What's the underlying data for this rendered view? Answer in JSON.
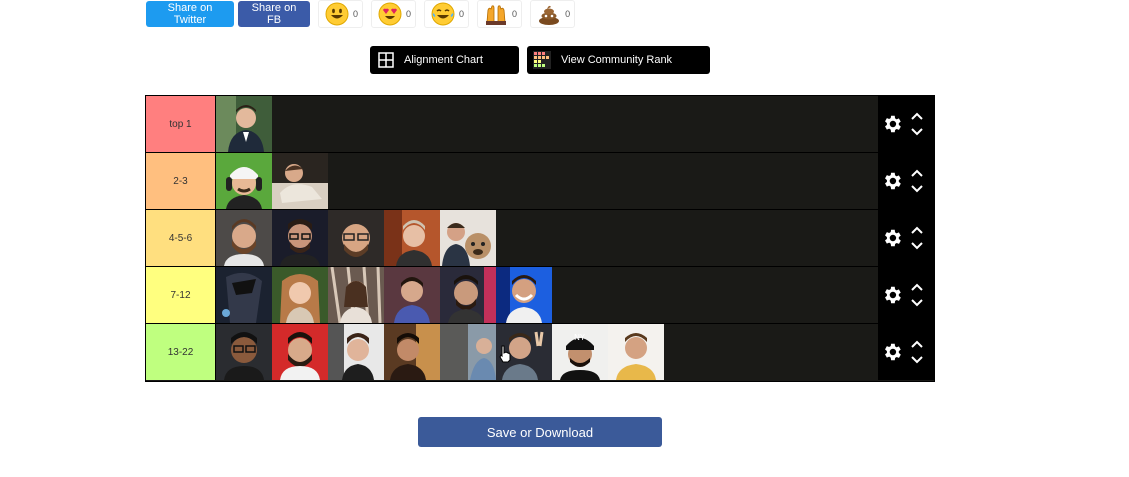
{
  "share": {
    "twitter_label": "Share on Twitter",
    "fb_label": "Share on FB"
  },
  "reactions": [
    {
      "icon": "smiley-face-icon",
      "count": "0"
    },
    {
      "icon": "heart-eyes-icon",
      "count": "0"
    },
    {
      "icon": "laughing-tears-icon",
      "count": "0"
    },
    {
      "icon": "raised-hands-icon",
      "count": "0"
    },
    {
      "icon": "poop-icon",
      "count": "0"
    }
  ],
  "toolbar": {
    "alignment_label": "Alignment Chart",
    "community_label": "View Community Rank"
  },
  "tiers": [
    {
      "label": "top 1",
      "color": "#ff7f7f",
      "items": 1
    },
    {
      "label": "2-3",
      "color": "#ffbf7f",
      "items": 2
    },
    {
      "label": "4-5-6",
      "color": "#ffdf7f",
      "items": 5
    },
    {
      "label": "7-12",
      "color": "#ffff7f",
      "items": 6
    },
    {
      "label": "13-22",
      "color": "#bfff7f",
      "items": 8
    }
  ],
  "save_label": "Save or Download"
}
